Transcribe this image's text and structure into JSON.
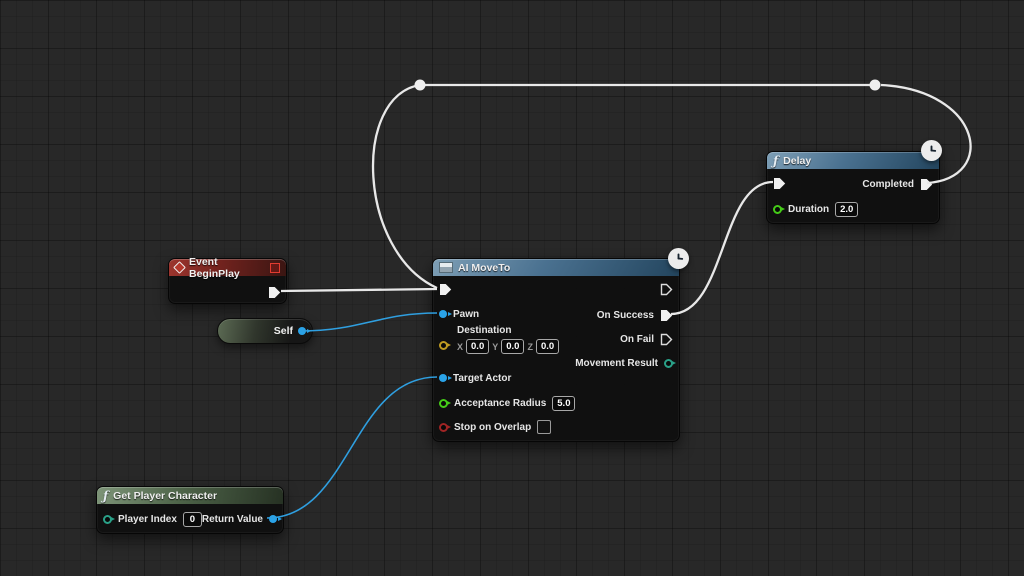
{
  "colors": {
    "background": "#282828",
    "exec_wire": "#e8e8e8",
    "data_wire_blue": "#2f9fe0",
    "pin_object_blue": "#2aa3e8",
    "pin_vector_gold": "#bf9b22",
    "pin_float_green": "#45cc18",
    "pin_enum_teal": "#2aa188",
    "pin_bool_red": "#a02424",
    "header_event_red": "#76241f",
    "header_function_blue": "#4a7190",
    "header_pure_green": "#4e6449"
  },
  "nodes": {
    "event_begin_play": {
      "title": "Event BeginPlay"
    },
    "self": {
      "label": "Self"
    },
    "ai_move_to": {
      "title": "AI MoveTo",
      "pins": {
        "pawn": {
          "label": "Pawn"
        },
        "destination": {
          "label": "Destination",
          "axes": [
            {
              "axis": "X",
              "value": "0.0"
            },
            {
              "axis": "Y",
              "value": "0.0"
            },
            {
              "axis": "Z",
              "value": "0.0"
            }
          ]
        },
        "target_actor": {
          "label": "Target Actor"
        },
        "acceptance_radius": {
          "label": "Acceptance Radius",
          "value": "5.0"
        },
        "stop_on_overlap": {
          "label": "Stop on Overlap"
        },
        "on_success": {
          "label": "On Success"
        },
        "on_fail": {
          "label": "On Fail"
        },
        "movement_result": {
          "label": "Movement Result"
        }
      }
    },
    "delay": {
      "title": "Delay",
      "icon": "ƒ",
      "pins": {
        "completed": {
          "label": "Completed"
        },
        "duration": {
          "label": "Duration",
          "value": "2.0"
        }
      }
    },
    "get_player_character": {
      "title": "Get Player Character",
      "icon": "ƒ",
      "pins": {
        "player_index": {
          "label": "Player Index",
          "value": "0"
        },
        "return_value": {
          "label": "Return Value"
        }
      }
    }
  }
}
